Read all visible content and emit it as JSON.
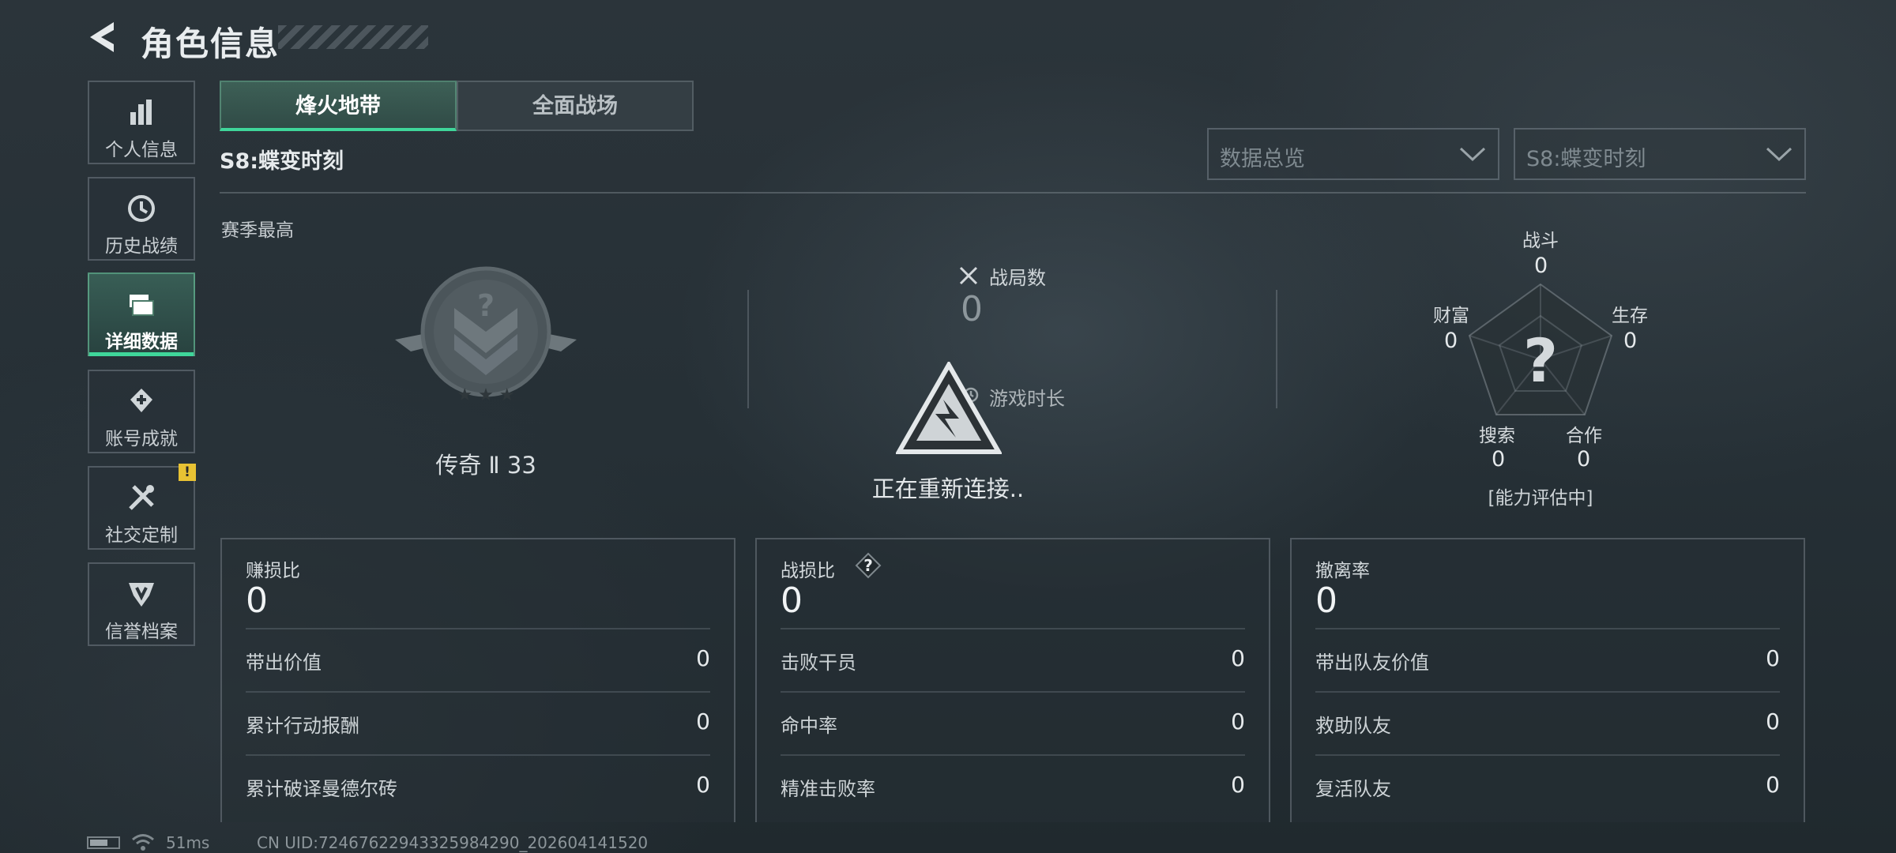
{
  "header": {
    "title": "角色信息",
    "back_icon": "back-arrow-icon"
  },
  "sidebar": {
    "items": [
      {
        "label": "个人信息",
        "icon": "bar-chart-icon"
      },
      {
        "label": "历史战绩",
        "icon": "history-clock-icon"
      },
      {
        "label": "详细数据",
        "icon": "folder-icon",
        "active": true
      },
      {
        "label": "账号成就",
        "icon": "achievement-icon"
      },
      {
        "label": "社交定制",
        "icon": "tools-icon",
        "badge": "!"
      },
      {
        "label": "信誉档案",
        "icon": "credit-shield-icon"
      }
    ]
  },
  "tabs": [
    {
      "label": "烽火地带",
      "active": true
    },
    {
      "label": "全面战场"
    }
  ],
  "season_title": "S8:蝶变时刻",
  "dropdowns": [
    {
      "value": "数据总览"
    },
    {
      "value": "S8:蝶变时刻"
    }
  ],
  "season_best": {
    "label": "赛季最高",
    "rank": "传奇 Ⅱ 33"
  },
  "center": {
    "battles_label": "战局数",
    "battles_value": "0",
    "time_label": "游戏时长",
    "reconnect_text": "正在重新连接.."
  },
  "radar": {
    "axes": [
      {
        "label": "战斗",
        "value": "0"
      },
      {
        "label": "生存",
        "value": "0"
      },
      {
        "label": "合作",
        "value": "0"
      },
      {
        "label": "搜索",
        "value": "0"
      },
      {
        "label": "财富",
        "value": "0"
      }
    ],
    "center_symbol": "?",
    "note": "[能力评估中]"
  },
  "panels": [
    {
      "title": "赚损比",
      "value": "0",
      "rows": [
        {
          "label": "带出价值",
          "value": "0"
        },
        {
          "label": "累计行动报酬",
          "value": "0"
        },
        {
          "label": "累计破译曼德尔砖",
          "value": "0"
        }
      ]
    },
    {
      "title": "战损比",
      "value": "0",
      "help": "?",
      "rows": [
        {
          "label": "击败干员",
          "value": "0"
        },
        {
          "label": "命中率",
          "value": "0"
        },
        {
          "label": "精准击败率",
          "value": "0"
        }
      ]
    },
    {
      "title": "撤离率",
      "value": "0",
      "rows": [
        {
          "label": "带出队友价值",
          "value": "0"
        },
        {
          "label": "救助队友",
          "value": "0"
        },
        {
          "label": "复活队友",
          "value": "0"
        }
      ]
    }
  ],
  "footer": {
    "ping": "51ms",
    "uid": "CN UID:72467622943325984290_202604141520"
  },
  "colors": {
    "accent": "#3fd69a",
    "badge": "#e8c233",
    "background": "#263036"
  }
}
